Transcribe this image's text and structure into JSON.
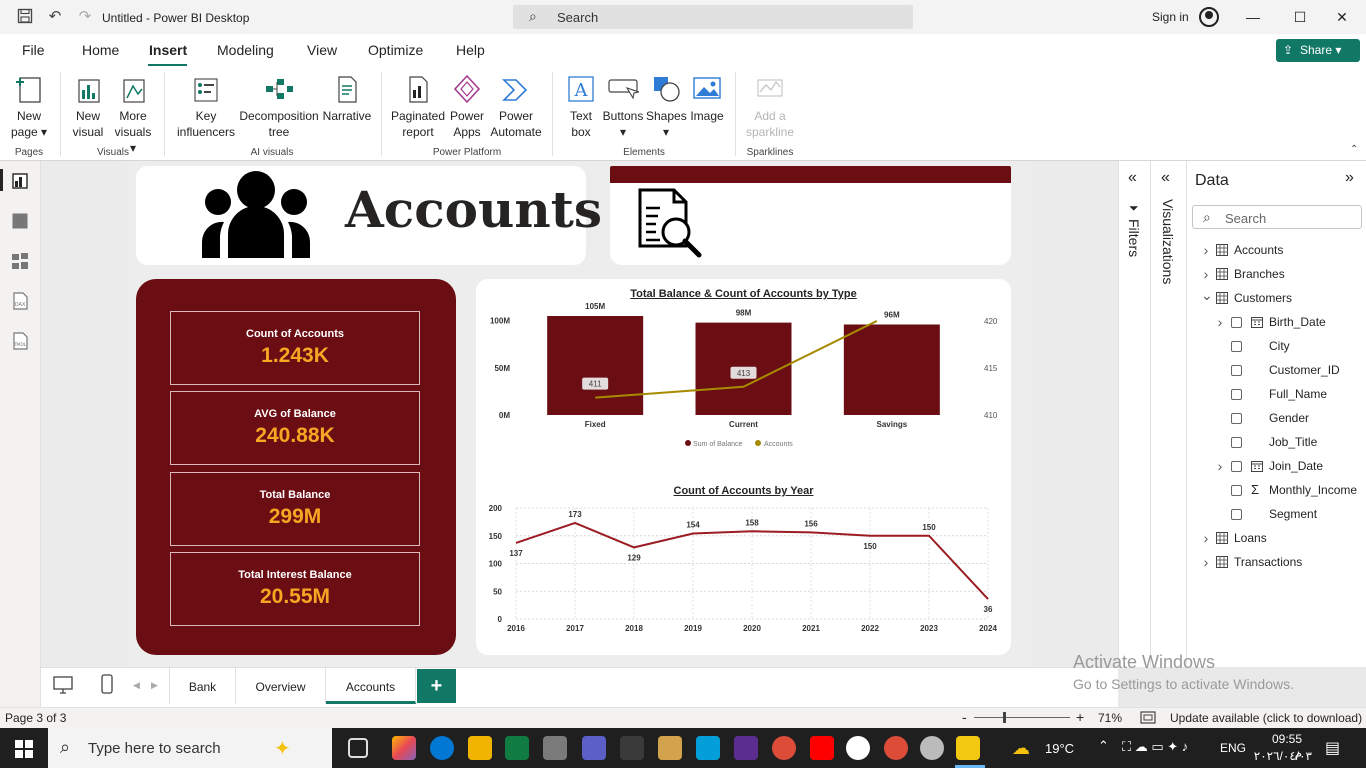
{
  "titlebar": {
    "app_title": "Untitled - Power BI Desktop",
    "search_label": "Search",
    "signin": "Sign in",
    "minimize": "—",
    "maximize": "☐",
    "close": "✕"
  },
  "menu": {
    "tabs": [
      "File",
      "Home",
      "Insert",
      "Modeling",
      "View",
      "Optimize",
      "Help"
    ],
    "active_tab": "Insert",
    "share": "Share"
  },
  "ribbon": {
    "new_page": [
      "New",
      "page ▾"
    ],
    "new_visual": [
      "New",
      "visual"
    ],
    "more_visuals": [
      "More",
      "visuals ▾"
    ],
    "key_influencers": [
      "Key",
      "influencers"
    ],
    "decomposition_tree": [
      "Decomposition",
      "tree"
    ],
    "narrative": "Narrative",
    "paginated_report": [
      "Paginated",
      "report"
    ],
    "power_apps": [
      "Power",
      "Apps"
    ],
    "power_automate": [
      "Power",
      "Automate"
    ],
    "text_box": [
      "Text",
      "box"
    ],
    "buttons": [
      "Buttons",
      "▾"
    ],
    "shapes": [
      "Shapes",
      "▾"
    ],
    "image": "Image",
    "add_sparkline": [
      "Add a",
      "sparkline"
    ],
    "groups": {
      "pages": "Pages",
      "visuals": "Visuals",
      "ai_visuals": "AI visuals",
      "power_platform": "Power Platform",
      "elements": "Elements",
      "sparklines": "Sparklines"
    }
  },
  "report": {
    "title": "Accounts",
    "kpis": [
      {
        "label": "Count of Accounts",
        "value": "1.243K"
      },
      {
        "label": "AVG of Balance",
        "value": "240.88K"
      },
      {
        "label": "Total Balance",
        "value": "299M"
      },
      {
        "label": "Total Interest Balance",
        "value": "20.55M"
      }
    ]
  },
  "colors": {
    "maroon": "#6b0e14",
    "kpi_value": "#f7a623",
    "line_gold": "#a68a00",
    "year_line": "#9b1c22",
    "accent": "#117865"
  },
  "chart_data": [
    {
      "type": "bar",
      "title": "Total Balance & Count of Accounts by Type",
      "categories": [
        "Fixed",
        "Current",
        "Savings"
      ],
      "series": [
        {
          "name": "Sum of Balance",
          "values": [
            105,
            98,
            96
          ],
          "axis": "left",
          "kind": "bar"
        },
        {
          "name": "Accounts",
          "values": [
            411,
            413,
            420
          ],
          "axis": "right",
          "kind": "line"
        }
      ],
      "bar_labels": [
        "105M",
        "98M",
        "96M"
      ],
      "line_labels": [
        "411",
        "413",
        ""
      ],
      "y_ticks": [
        "100M",
        "50M",
        "0M"
      ],
      "y_ticks_right": [
        "420",
        "415",
        "410"
      ],
      "ylim": [
        0,
        105
      ],
      "ylim_right": [
        410,
        420
      ],
      "legend": "bottom"
    },
    {
      "type": "line",
      "title": "Count of Accounts by Year",
      "x": [
        "2016",
        "2017",
        "2018",
        "2019",
        "2020",
        "2021",
        "2022",
        "2023",
        "2024"
      ],
      "values": [
        137,
        173,
        129,
        154,
        158,
        156,
        150,
        150,
        36
      ],
      "y_ticks": [
        "200",
        "150",
        "100",
        "50",
        "0"
      ],
      "ylim": [
        0,
        200
      ],
      "grid": true
    }
  ],
  "filters_label": "Filters",
  "viz_label": "Visualizations",
  "data_pane": {
    "title": "Data",
    "search_placeholder": "Search",
    "tables": [
      {
        "name": "Accounts",
        "expanded": false
      },
      {
        "name": "Branches",
        "expanded": false
      },
      {
        "name": "Customers",
        "expanded": true
      },
      {
        "name": "Loans",
        "expanded": false
      },
      {
        "name": "Transactions",
        "expanded": false
      }
    ],
    "customer_fields": [
      "Birth_Date",
      "City",
      "Customer_ID",
      "Full_Name",
      "Gender",
      "Job_Title",
      "Join_Date",
      "Monthly_Income",
      "Segment"
    ]
  },
  "page_tabs": [
    "Bank",
    "Overview",
    "Accounts"
  ],
  "active_page": "Accounts",
  "add_page": "+",
  "status": {
    "page": "Page 3 of 3",
    "zoom_minus": "-",
    "zoom_plus": "+",
    "zoom": "71%",
    "update": "Update available (click to download)"
  },
  "watermark": {
    "line1": "Activate Windows",
    "line2": "Go to Settings to activate Windows."
  },
  "taskbar": {
    "search": "Type here to search",
    "weather": "19°C",
    "lang": "ENG",
    "time": "09:55 م",
    "date": "٢٠٢٦/٠٤/٠٣"
  }
}
